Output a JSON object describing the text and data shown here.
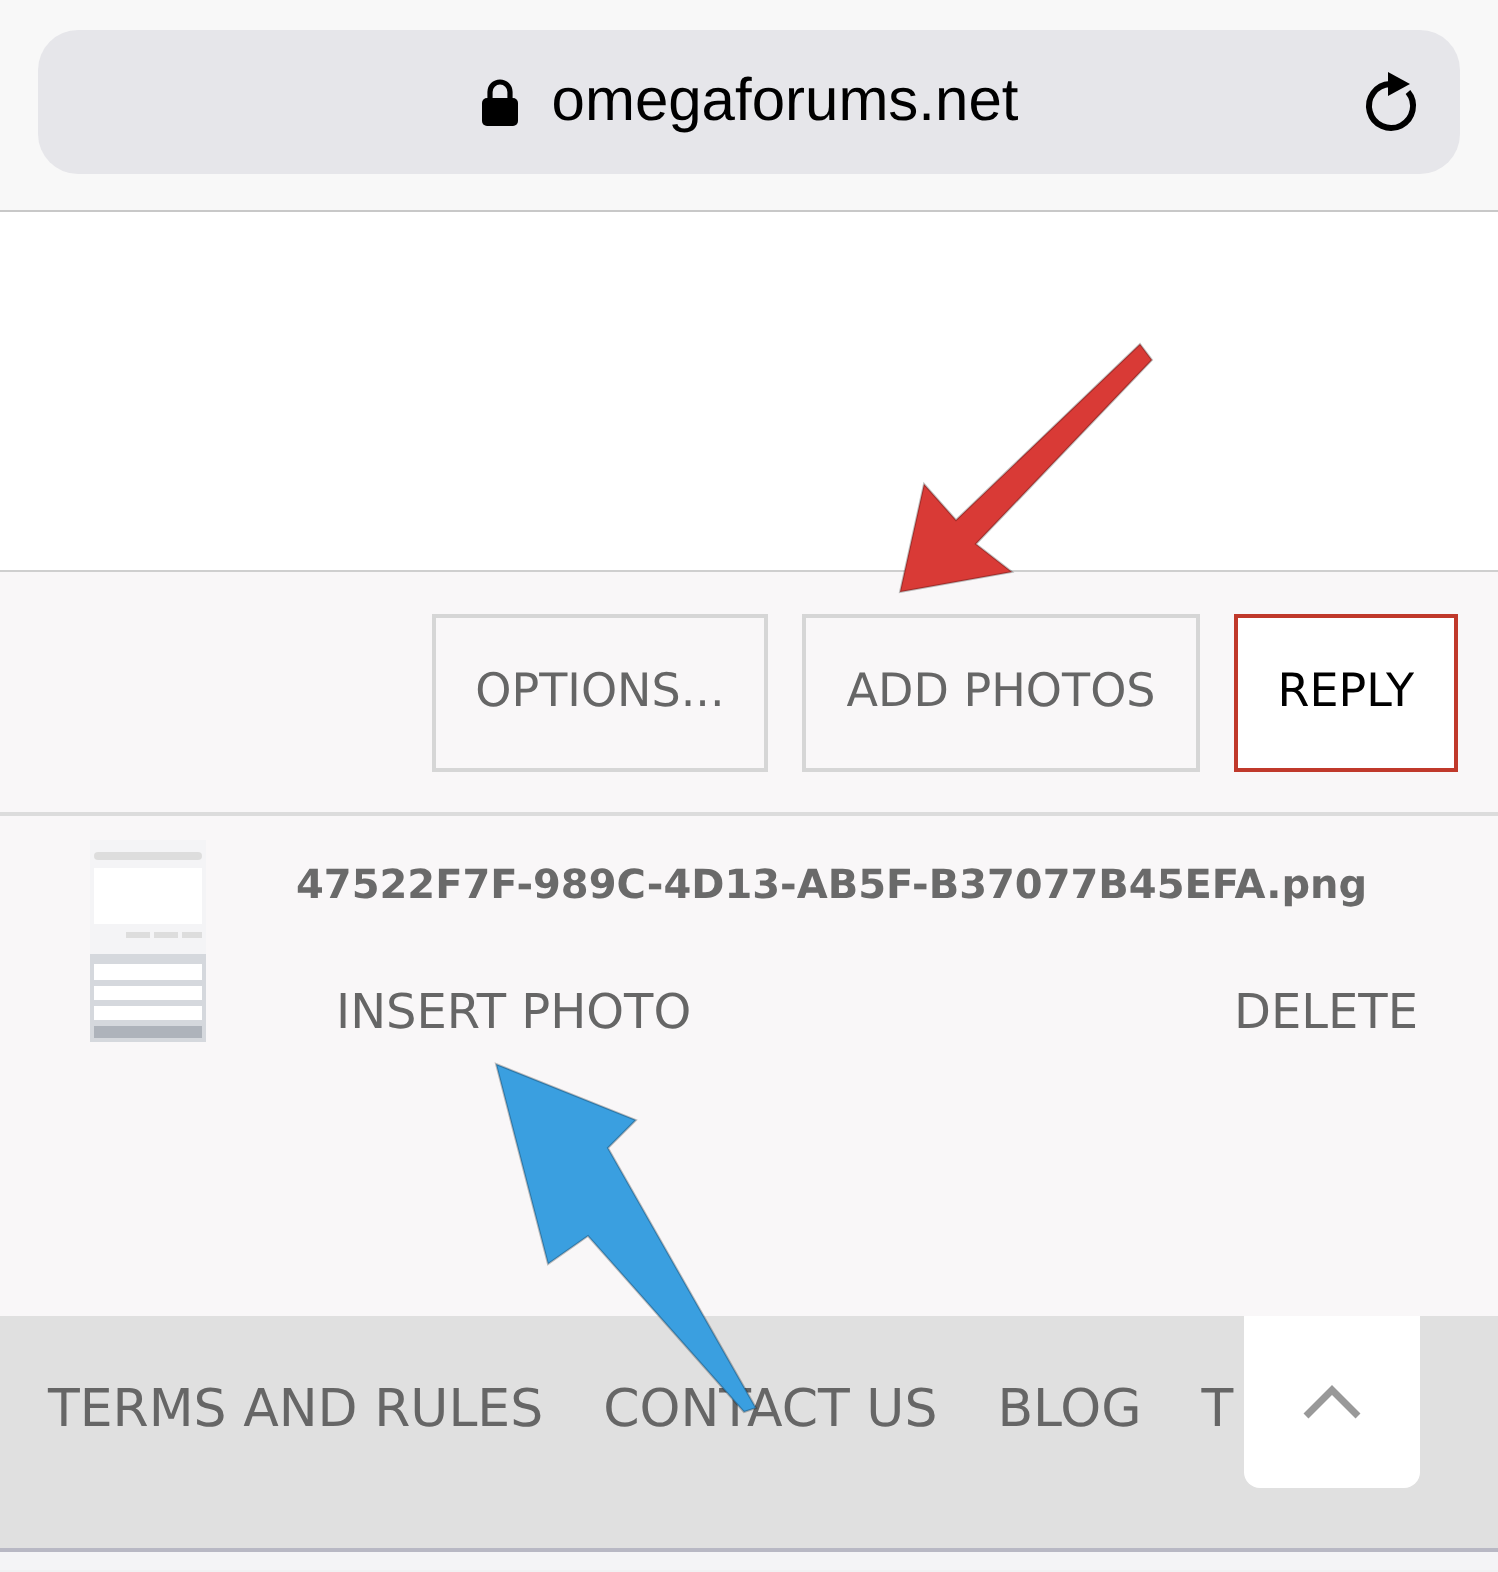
{
  "address_bar": {
    "url": "omegaforums.net",
    "secure": true
  },
  "toolbar": {
    "buttons": [
      {
        "label": "OPTIONS...",
        "kind": "plain"
      },
      {
        "label": "ADD PHOTOS",
        "kind": "plain"
      },
      {
        "label": "REPLY",
        "kind": "primary"
      }
    ]
  },
  "attachment": {
    "filename": "47522F7F-989C-4D13-AB5F-B37077B45EFA.png",
    "insert_label": "INSERT PHOTO",
    "delete_label": "DELETE"
  },
  "footer": {
    "links": [
      "TERMS AND RULES",
      "CONTACT US",
      "BLOG",
      "T"
    ]
  },
  "annotations": [
    {
      "kind": "arrow",
      "color": "#d93a36"
    },
    {
      "kind": "arrow",
      "color": "#3a9fe0"
    }
  ]
}
